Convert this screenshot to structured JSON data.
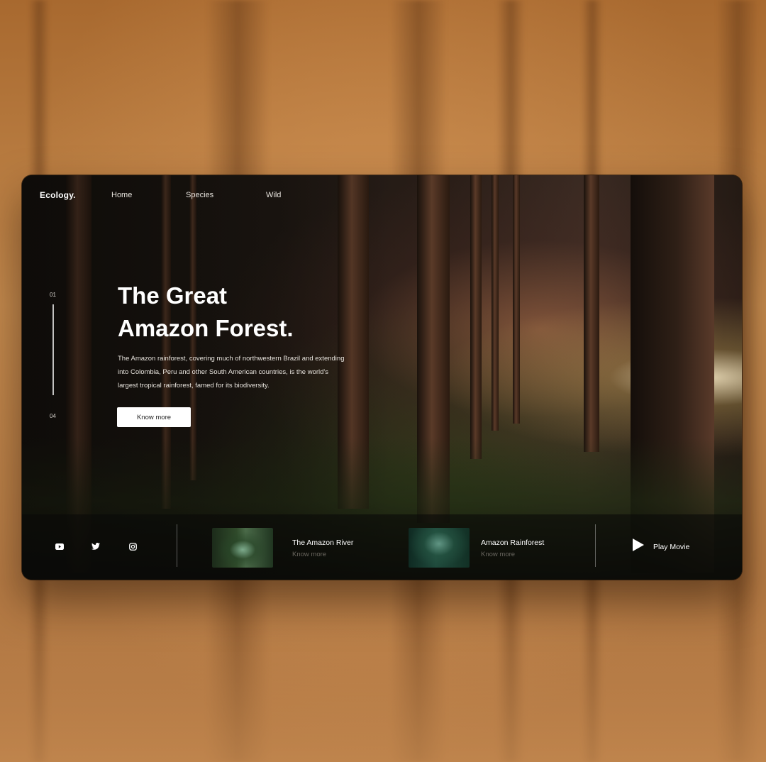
{
  "nav": {
    "brand": "Ecology.",
    "links": [
      "Home",
      "Species",
      "Wild"
    ]
  },
  "pager": {
    "current": "01",
    "total": "04"
  },
  "hero": {
    "title": "The Great\nAmazon Forest.",
    "description": "The Amazon rainforest, covering much of northwestern Brazil and extending into Colombia, Peru and other South American countries, is the world's largest tropical rainforest, famed for its biodiversity.",
    "cta_label": "Know more"
  },
  "social": [
    "youtube-icon",
    "twitter-icon",
    "instagram-icon"
  ],
  "features": [
    {
      "title": "The Amazon River",
      "link": "Know more"
    },
    {
      "title": "Amazon Rainforest",
      "link": "Know more"
    }
  ],
  "play": {
    "label": "Play Movie"
  },
  "colors": {
    "accent": "#ffffff",
    "backdrop": "#b0743c",
    "card": "#0f0d0a"
  }
}
